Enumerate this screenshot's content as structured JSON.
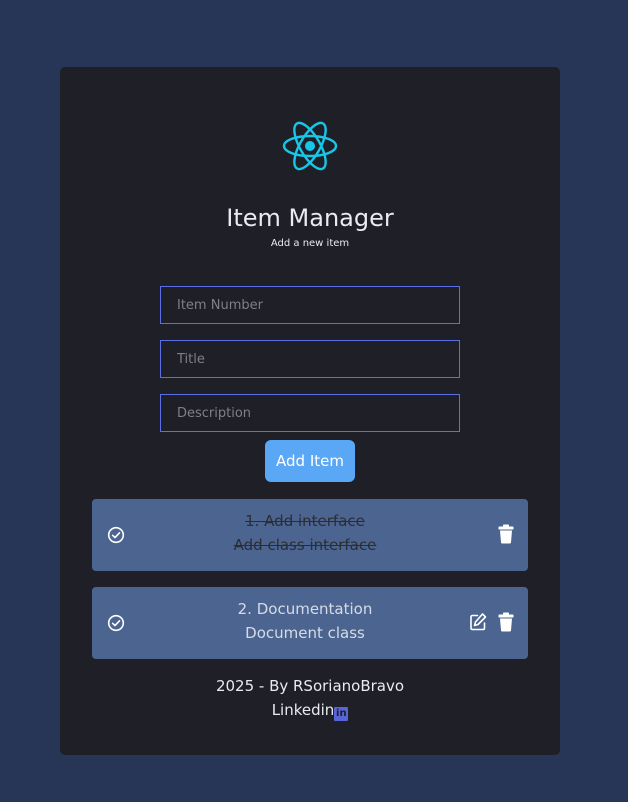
{
  "header": {
    "logo_icon": "react-atom-icon",
    "title": "Item Manager",
    "subtitle": "Add a new item"
  },
  "form": {
    "item_number_placeholder": "Item Number",
    "title_placeholder": "Title",
    "description_placeholder": "Description",
    "item_number_value": "",
    "title_value": "",
    "description_value": "",
    "add_button_label": "Add Item"
  },
  "items": [
    {
      "line1": "1. Add interface",
      "line2": "Add class interface",
      "completed": true,
      "check_icon": "check-circle-icon",
      "delete_icon": "trash-icon"
    },
    {
      "line1": "2. Documentation",
      "line2": "Document class",
      "completed": false,
      "check_icon": "check-circle-icon",
      "edit_icon": "edit-icon",
      "delete_icon": "trash-icon"
    }
  ],
  "footer": {
    "credit": "2025 - By RSorianoBravo",
    "linkedin_label": "Linkedin",
    "linkedin_badge": "in",
    "linkedin_icon": "linkedin-icon"
  },
  "colors": {
    "page_background": "#273657",
    "card_background": "#1f1f27",
    "accent": "#5aa8f5",
    "input_border": "#5a6ee6",
    "item_background": "#4c6590",
    "logo": "#17c7e8",
    "linkedin": "#5865d8"
  }
}
